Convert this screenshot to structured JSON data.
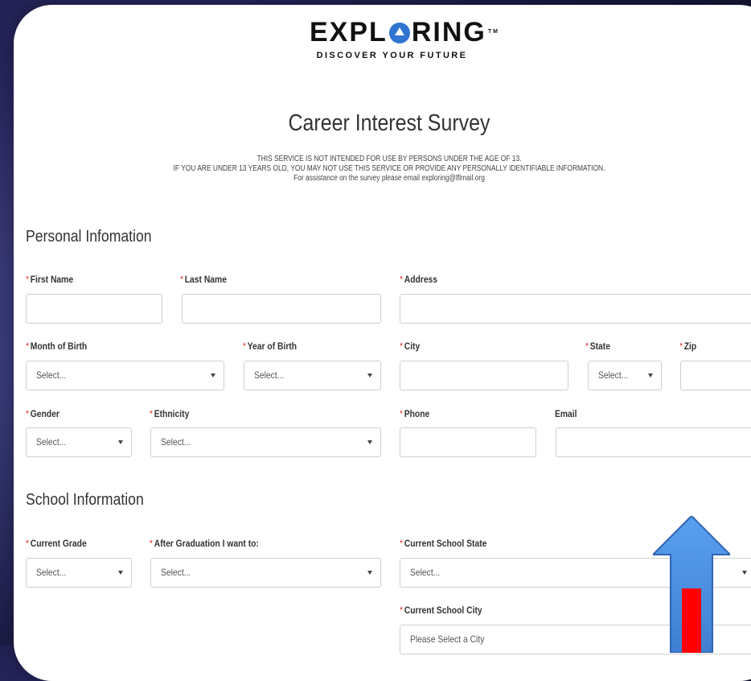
{
  "brand": {
    "name": "EXPL",
    "name_rest": "RING",
    "trademark": "TM",
    "tagline": "DISCOVER YOUR FUTURE",
    "accent": "#2f74d0"
  },
  "page": {
    "title": "Career Interest Survey",
    "notice_lines": [
      "THIS SERVICE IS NOT INTENDED FOR USE BY PERSONS UNDER THE AGE OF 13.",
      "IF YOU ARE UNDER 13 YEARS OLD, YOU MAY NOT USE THIS SERVICE OR PROVIDE ANY PERSONALLY IDENTIFIABLE INFORMATION.",
      "For assistance on the survey please email exploring@lflmail.org"
    ]
  },
  "sections": {
    "personal": {
      "title": "Personal Infomation",
      "fields": {
        "first_name": {
          "label": "First Name",
          "value": ""
        },
        "last_name": {
          "label": "Last Name",
          "value": ""
        },
        "address": {
          "label": "Address",
          "value": ""
        },
        "month_of_birth": {
          "label": "Month of Birth",
          "value": "Select..."
        },
        "year_of_birth": {
          "label": "Year of Birth",
          "value": "Select..."
        },
        "city": {
          "label": "City",
          "value": ""
        },
        "state": {
          "label": "State",
          "value": "Select..."
        },
        "zip": {
          "label": "Zip",
          "value": ""
        },
        "gender": {
          "label": "Gender",
          "value": "Select..."
        },
        "ethnicity": {
          "label": "Ethnicity",
          "value": "Select..."
        },
        "phone": {
          "label": "Phone",
          "value": ""
        },
        "email": {
          "label": "Email",
          "value": ""
        }
      }
    },
    "school": {
      "title": "School Information",
      "fields": {
        "current_grade": {
          "label": "Current Grade",
          "value": "Select..."
        },
        "after_graduation": {
          "label": "After Graduation I want to:",
          "value": "Select..."
        },
        "school_state": {
          "label": "Current School State",
          "value": "Select..."
        },
        "school_city": {
          "label": "Current School City",
          "value": "Please Select a City"
        }
      }
    }
  },
  "required_marker": "*",
  "colors": {
    "required": "#d9382c",
    "arrow_blue": "#4a90e2",
    "arrow_red": "#ff0000"
  }
}
